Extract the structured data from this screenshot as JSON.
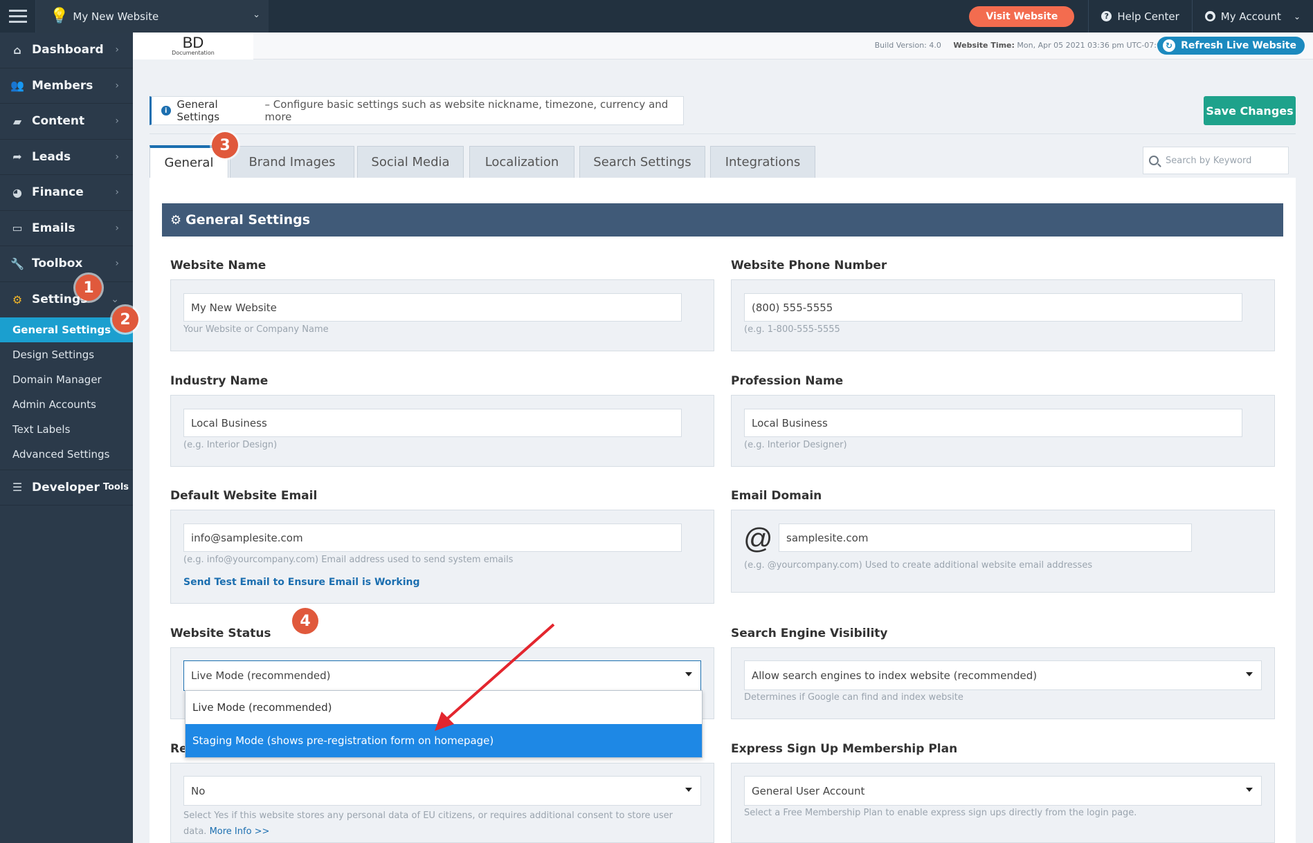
{
  "topbar": {
    "site_name": "My New Website",
    "visit_label": "Visit Website",
    "help_label": "Help Center",
    "account_label": "My Account"
  },
  "brand": {
    "logo_text": "BD",
    "logo_sub": "Documentation",
    "build_label": "Build Version:",
    "build_value": "4.0",
    "time_label": "Website Time:",
    "time_value": "Mon, Apr 05 2021 03:36 pm UTC-07:00",
    "refresh_label": "Refresh Live Website"
  },
  "sidebar": {
    "items": [
      {
        "label": "Dashboard",
        "icon": "home-icon"
      },
      {
        "label": "Members",
        "icon": "users-icon"
      },
      {
        "label": "Content",
        "icon": "folder-icon"
      },
      {
        "label": "Leads",
        "icon": "share-icon"
      },
      {
        "label": "Finance",
        "icon": "pie-chart-icon"
      },
      {
        "label": "Emails",
        "icon": "inbox-icon"
      },
      {
        "label": "Toolbox",
        "icon": "wrench-icon"
      },
      {
        "label": "Settings",
        "icon": "gear-icon"
      }
    ],
    "sub_items": [
      "General Settings",
      "Design Settings",
      "Domain Manager",
      "Admin Accounts",
      "Text Labels",
      "Advanced Settings"
    ],
    "developer_label": "Developer",
    "developer_small": "Tools"
  },
  "info": {
    "title": "General Settings",
    "description": "– Configure basic settings such as website nickname, timezone, currency and more"
  },
  "save_label": "Save Changes",
  "tabs": [
    "General",
    "Brand Images",
    "Social Media",
    "Localization",
    "Search Settings",
    "Integrations"
  ],
  "search_placeholder": "Search by Keyword",
  "panel_title": "General Settings",
  "fields": {
    "website_name": {
      "label": "Website Name",
      "value": "My New Website",
      "help": "Your Website or Company Name"
    },
    "phone": {
      "label": "Website Phone Number",
      "value": "(800) 555-5555",
      "help": "(e.g. 1-800-555-5555"
    },
    "industry": {
      "label": "Industry Name",
      "value": "Local Business",
      "help": "(e.g. Interior Design)"
    },
    "profession": {
      "label": "Profession Name",
      "value": "Local Business",
      "help": "(e.g. Interior Designer)"
    },
    "email": {
      "label": "Default Website Email",
      "value": "info@samplesite.com",
      "help": "(e.g. info@yourcompany.com) Email address used to send system emails",
      "link": "Send Test Email to Ensure Email is Working"
    },
    "email_domain": {
      "label": "Email Domain",
      "at": "@",
      "value": "samplesite.com",
      "help": "(e.g. @yourcompany.com) Used to create additional website email addresses"
    },
    "status": {
      "label": "Website Status",
      "value": "Live Mode (recommended)",
      "options": [
        "Live Mode (recommended)",
        "Staging Mode (shows pre-registration form on homepage)"
      ]
    },
    "visibility": {
      "label": "Search Engine Visibility",
      "value": "Allow search engines to index website (recommended)",
      "help": "Determines if Google can find and index website"
    },
    "gdpr": {
      "label_partial": "Re",
      "value": "No",
      "help": "Select Yes if this website stores any personal data of EU citizens, or requires additional consent to store user data.",
      "more": "More Info >>"
    },
    "express": {
      "label": "Express Sign Up Membership Plan",
      "value": "General User Account",
      "help": "Select a Free Membership Plan to enable express sign ups directly from the login page."
    }
  },
  "badges": [
    "1",
    "2",
    "3",
    "4"
  ],
  "colors": {
    "accent": "#1b9fcf",
    "save": "#1ea28b",
    "visit": "#f36c4f",
    "badge": "#e0593c",
    "header": "#405a78"
  }
}
